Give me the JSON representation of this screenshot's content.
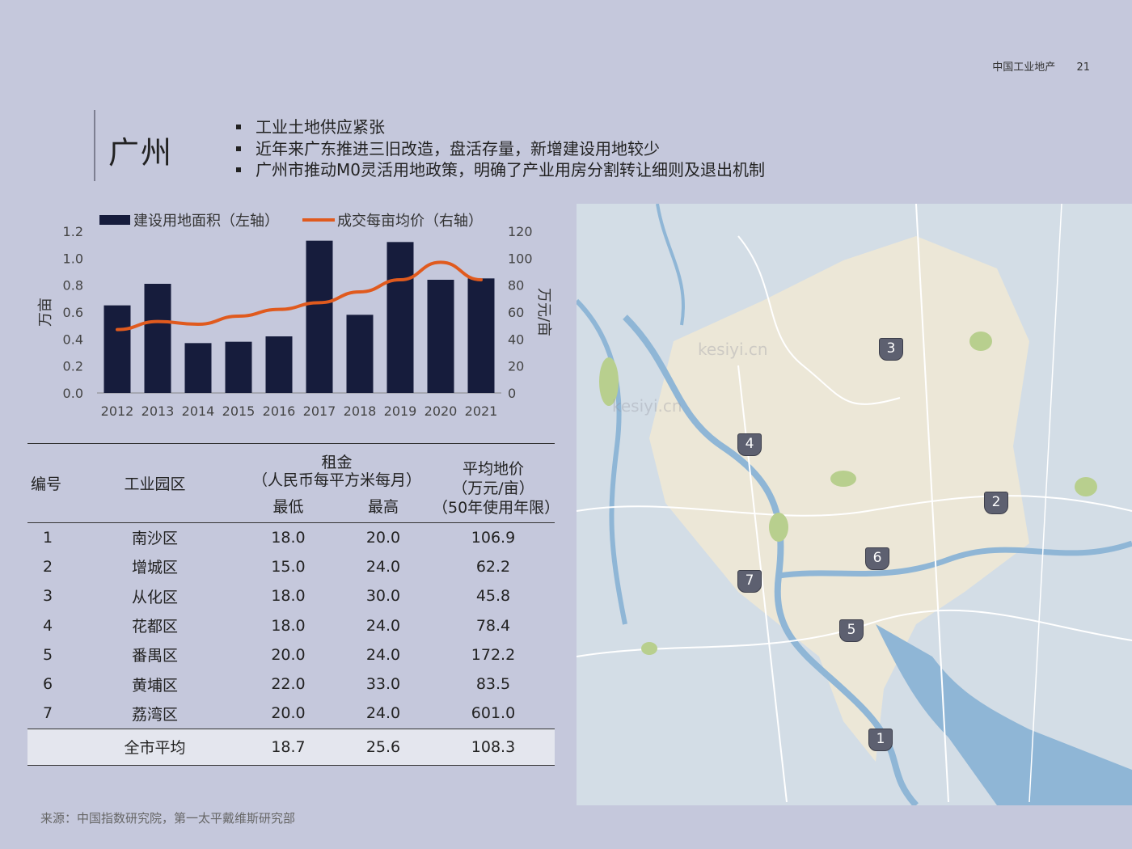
{
  "header": {
    "section": "中国工业地产",
    "page": "21"
  },
  "title": "广州",
  "bullets": [
    "工业土地供应紧张",
    "近年来广东推进三旧改造，盘活存量，新增建设用地较少",
    "广州市推动M0灵活用地政策，明确了产业用房分割转让细则及退出机制"
  ],
  "chart_data": {
    "type": "bar",
    "categories": [
      "2012",
      "2013",
      "2014",
      "2015",
      "2016",
      "2017",
      "2018",
      "2019",
      "2020",
      "2021"
    ],
    "series": [
      {
        "name": "建设用地面积（左轴）",
        "type": "bar",
        "axis": "left",
        "color": "#161c3c",
        "values": [
          0.65,
          0.81,
          0.37,
          0.38,
          0.42,
          1.13,
          0.58,
          1.12,
          0.84,
          0.85
        ]
      },
      {
        "name": "成交每亩均价（右轴）",
        "type": "line",
        "axis": "right",
        "color": "#e05a1e",
        "values": [
          47,
          53,
          51,
          57,
          62,
          67,
          75,
          84,
          97,
          84
        ]
      }
    ],
    "y_left": {
      "label": "万亩",
      "range": [
        0,
        1.2
      ],
      "ticks": [
        "0.0",
        "0.2",
        "0.4",
        "0.6",
        "0.8",
        "1.0",
        "1.2"
      ]
    },
    "y_right": {
      "label": "万元/亩",
      "range": [
        0,
        120
      ],
      "ticks": [
        "0",
        "20",
        "40",
        "60",
        "80",
        "100",
        "120"
      ]
    },
    "legend": "top",
    "grid": false
  },
  "table": {
    "headers": {
      "id": "编号",
      "park": "工业园区",
      "rent": "租金",
      "rent_unit": "（人民币每平方米每月）",
      "min": "最低",
      "max": "最高",
      "price": "平均地价",
      "price_unit": "（万元/亩）",
      "price_note": "（50年使用年限）"
    },
    "rows": [
      {
        "id": "1",
        "park": "南沙区",
        "min": "18.0",
        "max": "20.0",
        "price": "106.9"
      },
      {
        "id": "2",
        "park": "增城区",
        "min": "15.0",
        "max": "24.0",
        "price": "62.2"
      },
      {
        "id": "3",
        "park": "从化区",
        "min": "18.0",
        "max": "30.0",
        "price": "45.8"
      },
      {
        "id": "4",
        "park": "花都区",
        "min": "18.0",
        "max": "24.0",
        "price": "78.4"
      },
      {
        "id": "5",
        "park": "番禺区",
        "min": "20.0",
        "max": "24.0",
        "price": "172.2"
      },
      {
        "id": "6",
        "park": "黄埔区",
        "min": "22.0",
        "max": "33.0",
        "price": "83.5"
      },
      {
        "id": "7",
        "park": "荔湾区",
        "min": "20.0",
        "max": "24.0",
        "price": "601.0"
      }
    ],
    "average": {
      "label": "全市平均",
      "min": "18.7",
      "max": "25.6",
      "price": "108.3"
    }
  },
  "map": {
    "markers": [
      "1",
      "2",
      "3",
      "4",
      "5",
      "6",
      "7"
    ],
    "watermark": "kesiyi.cn"
  },
  "source": "来源：中国指数研究院，第一太平戴维斯研究部"
}
